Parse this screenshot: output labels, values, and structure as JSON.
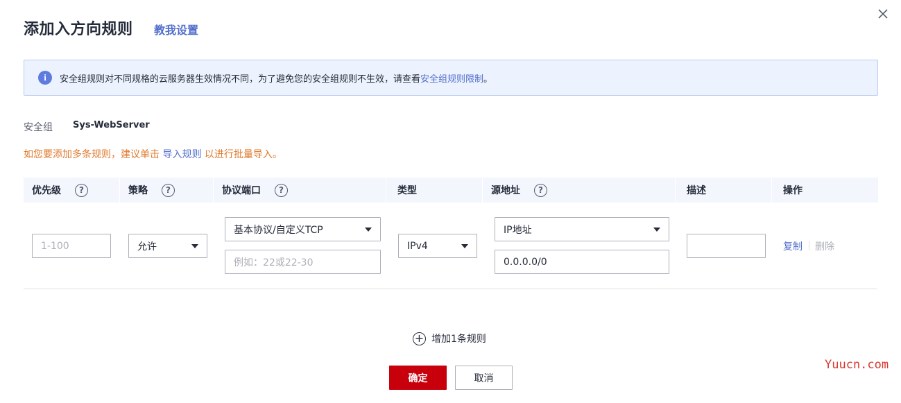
{
  "dialog": {
    "title": "添加入方向规则",
    "help_link": "教我设置"
  },
  "info": {
    "text": "安全组规则对不同规格的云服务器生效情况不同，为了避免您的安全组规则不生效，请查看",
    "link": "安全组规则限制",
    "suffix": "。"
  },
  "security_group": {
    "label": "安全组",
    "value": "Sys-WebServer"
  },
  "tip": {
    "prefix": "如您要添加多条规则，建议单击 ",
    "link": "导入规则",
    "suffix": " 以进行批量导入。"
  },
  "table": {
    "columns": [
      "优先级",
      "策略",
      "协议端口",
      "类型",
      "源地址",
      "描述",
      "操作"
    ],
    "row": {
      "priority_placeholder": "1-100",
      "policy": "允许",
      "protocol": "基本协议/自定义TCP",
      "port_placeholder": "例如：22或22-30",
      "type": "IPv4",
      "source_type": "IP地址",
      "source_value": "0.0.0.0/0",
      "description": "",
      "actions": {
        "copy": "复制",
        "delete": "删除"
      }
    }
  },
  "add_rule": "增加1条规则",
  "buttons": {
    "ok": "确定",
    "cancel": "取消"
  },
  "watermark": "Yuucn.com",
  "colors": {
    "primary": "#c7000b",
    "link": "#526ecc",
    "warning": "#e07a2d",
    "info_bg": "#edf3fe"
  }
}
